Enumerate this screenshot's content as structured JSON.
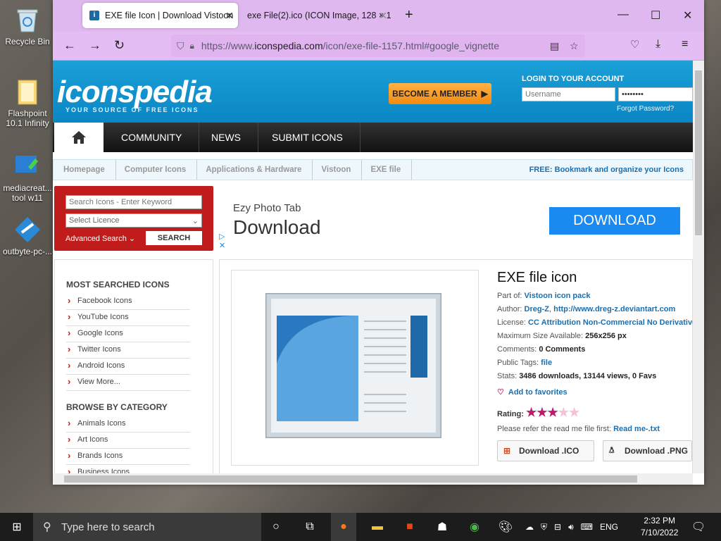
{
  "desktop": {
    "icons": [
      {
        "label": "Recycle Bin"
      },
      {
        "label": "Flashpoint 10.1 Infinity"
      },
      {
        "label": "mediacreat... tool w11"
      },
      {
        "label": "outbyte-pc-..."
      }
    ]
  },
  "browser": {
    "tabs": [
      {
        "title": "EXE file Icon | Download Vistoon"
      },
      {
        "title": "exe File(2).ico (ICON Image, 128 × 1"
      }
    ],
    "url_prefix": "https://www.",
    "url_host": "iconspedia.com",
    "url_path": "/icon/exe-file-1157.html#google_vignette"
  },
  "site": {
    "logo": "iconspedia",
    "tagline": "YOUR SOURCE OF FREE ICONS",
    "become_member": "BECOME A MEMBER",
    "login_title": "LOGIN TO YOUR ACCOUNT",
    "username_placeholder": "Username",
    "password_value": "••••••••",
    "forgot": "Forgot Password?",
    "menu": [
      "COMMUNITY",
      "NEWS",
      "SUBMIT ICONS"
    ],
    "breadcrumbs": [
      "Homepage",
      "Computer Icons",
      "Applications & Hardware",
      "Vistoon",
      "EXE file"
    ],
    "free_bookmark": "FREE: Bookmark and organize your Icons",
    "search_placeholder": "Search Icons - Enter Keyword",
    "select_licence": "Select Licence",
    "advanced_search": "Advanced Search",
    "search_btn": "SEARCH",
    "ad": {
      "sub": "Ezy Photo Tab",
      "title": "Download",
      "button": "DOWNLOAD"
    },
    "most_searched_title": "MOST SEARCHED ICONS",
    "most_searched": [
      "Facebook Icons",
      "YouTube Icons",
      "Google Icons",
      "Twitter Icons",
      "Android Icons",
      "View More..."
    ],
    "browse_title": "BROWSE BY CATEGORY",
    "browse": [
      "Animals Icons",
      "Art Icons",
      "Brands Icons",
      "Business Icons"
    ],
    "icon": {
      "title": "EXE file icon",
      "part_of_label": "Part of:",
      "part_of": "Vistoon icon pack",
      "author_label": "Author:",
      "author": "Dreg-Z",
      "author_url": "http://www.dreg-z.deviantart.com",
      "license_label": "License:",
      "license": "CC Attribution Non-Commercial No Derivatives",
      "maxsize_label": "Maximum Size Available:",
      "maxsize": "256x256 px",
      "comments_label": "Comments:",
      "comments": "0 Comments",
      "tags_label": "Public Tags:",
      "tags": "file",
      "stats_label": "Stats:",
      "stats": "3486 downloads, 13144 views, 0 Favs",
      "add_fav": "Add to favorites",
      "rating_label": "Rating:",
      "rating": 3,
      "readme_text": "Please refer the read me file first:",
      "readme_link": "Read me-.txt",
      "download_ico": "Download .ICO",
      "download_png": "Download .PNG"
    }
  },
  "taskbar": {
    "search_placeholder": "Type here to search",
    "lang": "ENG",
    "time": "2:32 PM",
    "date": "7/10/2022"
  },
  "colors": {
    "accent": "#1ba0d8",
    "red": "#c01c1c",
    "tab_bg": "#e0b8f0"
  }
}
